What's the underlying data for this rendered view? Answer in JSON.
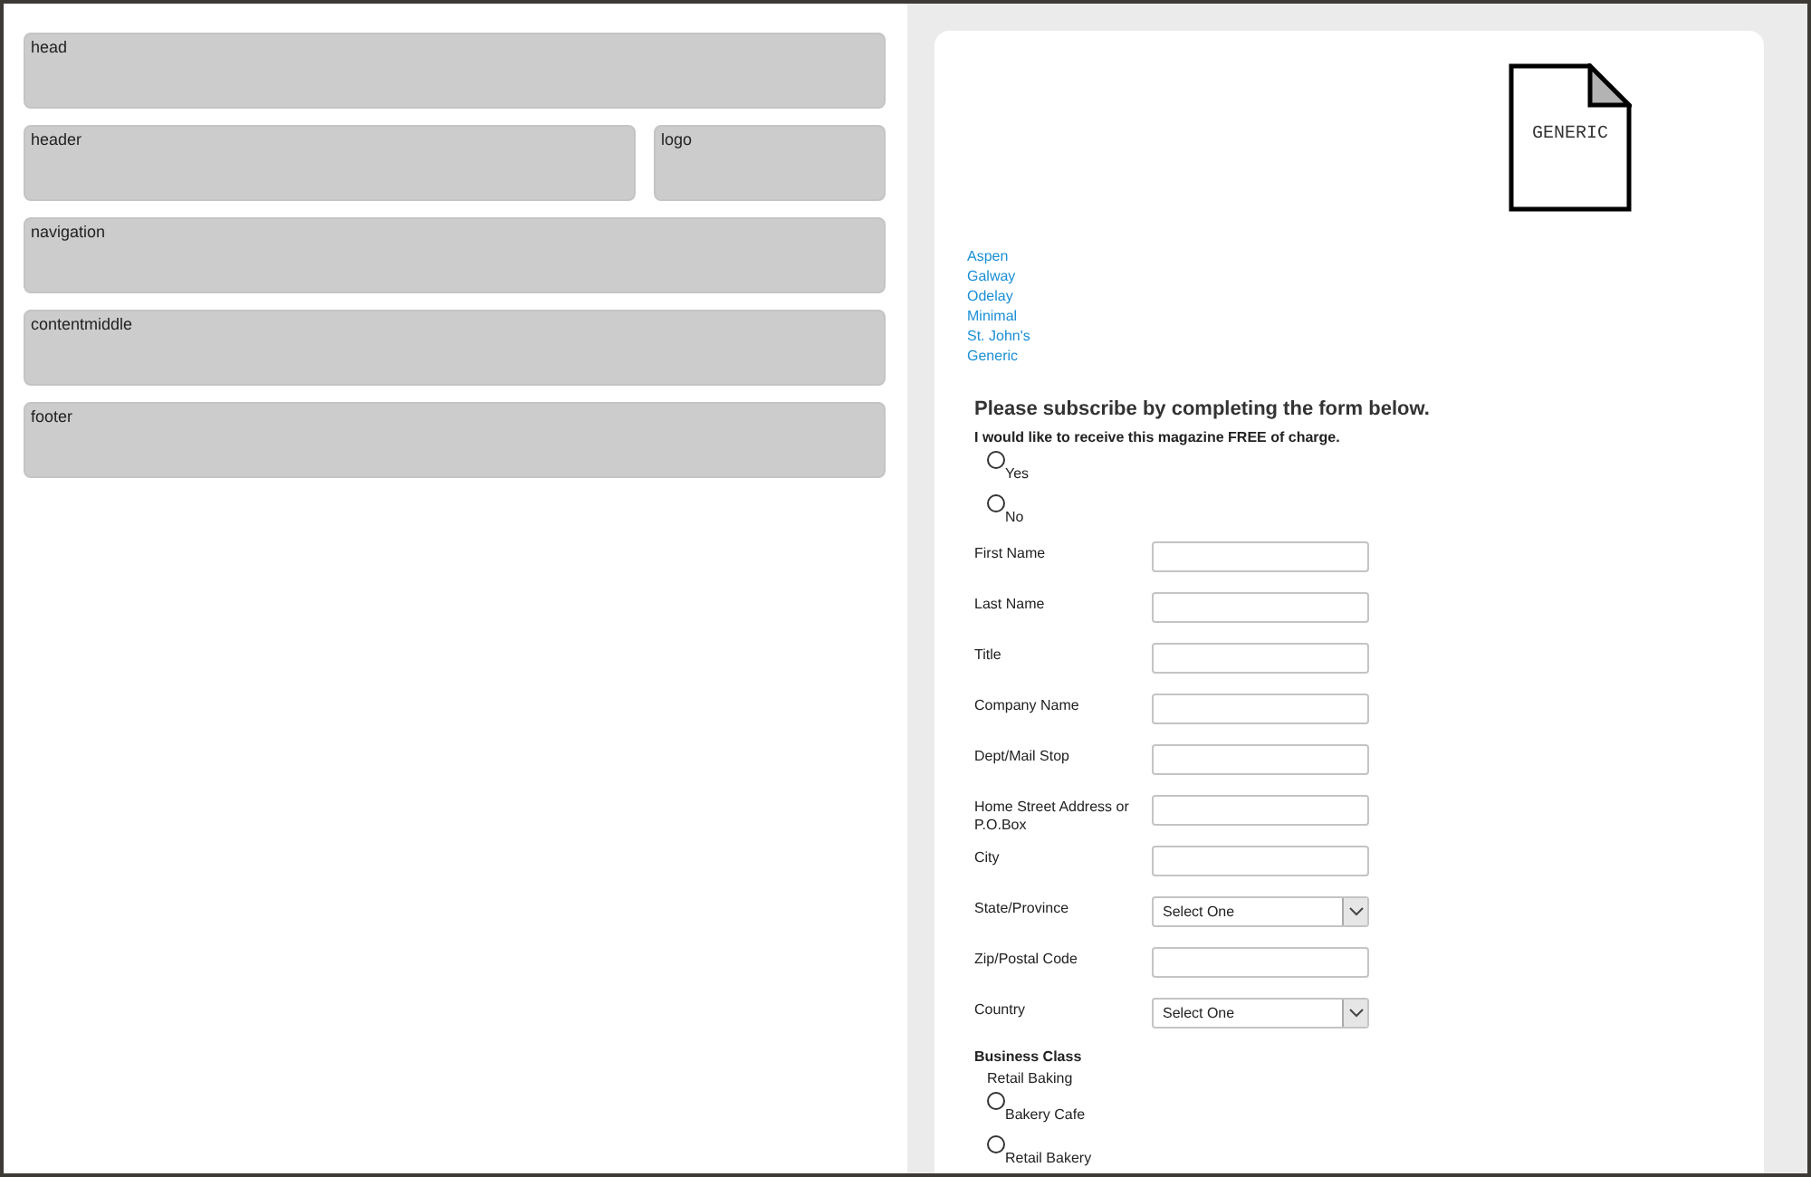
{
  "layout_blocks": [
    {
      "label": "head",
      "kind": "full"
    },
    {
      "label": "header",
      "kind": "wide"
    },
    {
      "label": "logo",
      "kind": "narrow"
    },
    {
      "label": "navigation",
      "kind": "full"
    },
    {
      "label": "contentmiddle",
      "kind": "full"
    },
    {
      "label": "footer",
      "kind": "full"
    }
  ],
  "preview": {
    "logo_text": "GENERIC",
    "theme_links": [
      "Aspen",
      "Galway",
      "Odelay",
      "Minimal",
      "St. John's",
      "Generic"
    ],
    "form": {
      "heading": "Please subscribe by completing the form below.",
      "question": "I would like to receive this magazine FREE of charge.",
      "answers": [
        {
          "label": "Yes",
          "selected": false
        },
        {
          "label": "No",
          "selected": false
        }
      ],
      "fields": [
        {
          "label": "First Name",
          "kind": "text"
        },
        {
          "label": "Last Name",
          "kind": "text"
        },
        {
          "label": "Title",
          "kind": "text"
        },
        {
          "label": "Company Name",
          "kind": "text"
        },
        {
          "label": "Dept/Mail Stop",
          "kind": "text"
        },
        {
          "label": "Home Street Address or P.O.Box",
          "kind": "text"
        },
        {
          "label": "City",
          "kind": "text"
        },
        {
          "label": "State/Province",
          "kind": "select",
          "value": "Select One"
        },
        {
          "label": "Zip/Postal Code",
          "kind": "text"
        },
        {
          "label": "Country",
          "kind": "select",
          "value": "Select One"
        }
      ],
      "business_class": {
        "title": "Business Class",
        "group": "Retail Baking",
        "options": [
          {
            "label": "Bakery Cafe",
            "selected": false
          },
          {
            "label": "Retail Bakery",
            "selected": false
          }
        ]
      }
    }
  }
}
